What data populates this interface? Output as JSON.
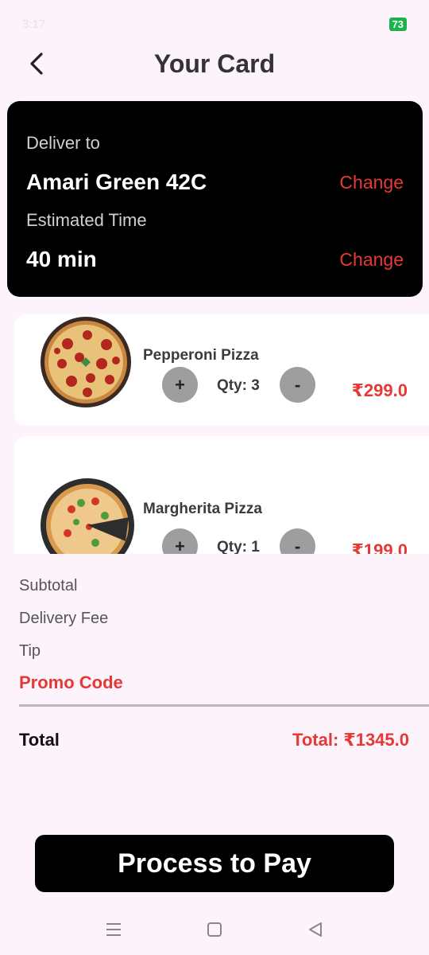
{
  "status_bar": {
    "time": "3:17",
    "battery": "73"
  },
  "header": {
    "title": "Your Card",
    "back_icon": "chevron-left-icon"
  },
  "delivery": {
    "deliver_to_label": "Deliver to",
    "address": "Amari Green 42C",
    "estimated_time_label": "Estimated Time",
    "time": "40 min",
    "change_label": "Change"
  },
  "cart": {
    "items": [
      {
        "name": "Pepperoni Pizza",
        "qty": "Qty: 3",
        "price": "₹299.0",
        "plus": "+",
        "minus": "-"
      },
      {
        "name": "Margherita Pizza",
        "qty": "Qty: 1",
        "price": "₹199.0",
        "plus": "+",
        "minus": "-"
      }
    ]
  },
  "summary": {
    "subtotal_label": "Subtotal",
    "delivery_fee_label": "Delivery Fee",
    "tip_label": "Tip",
    "promo_label": "Promo Code",
    "total_label": "Total",
    "total_value": "Total: ₹1345.0"
  },
  "pay_button": {
    "label": "Process to Pay"
  },
  "colors": {
    "accent": "#e53935",
    "background": "#fdf4fb",
    "card": "#000000"
  }
}
